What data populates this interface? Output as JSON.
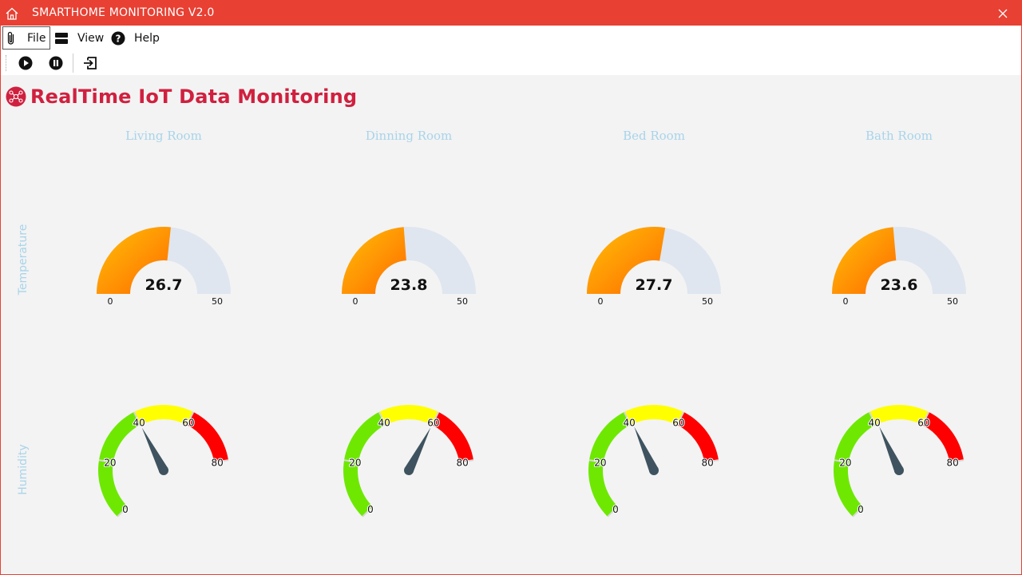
{
  "window": {
    "title": "SMARTHOME MONITORING V2.0"
  },
  "menu": {
    "file": "File",
    "view": "View",
    "help": "Help"
  },
  "toolbar": {
    "icons": [
      "play-icon",
      "pause-icon",
      "exit-icon"
    ]
  },
  "heading": {
    "text": "RealTime IoT Data Monitoring"
  },
  "rows": {
    "temperature": "Temperature",
    "humidity": "Humidity"
  },
  "rooms": [
    {
      "name": "Living Room",
      "temperature": 26.7,
      "temperature_label": "26.7",
      "humidity": 40
    },
    {
      "name": "Dinning Room",
      "temperature": 23.8,
      "temperature_label": "23.8",
      "humidity": 60
    },
    {
      "name": "Bed Room",
      "temperature": 27.7,
      "temperature_label": "27.7",
      "humidity": 41
    },
    {
      "name": "Bath Room",
      "temperature": 23.6,
      "temperature_label": "23.6",
      "humidity": 41
    }
  ],
  "temperature_scale": {
    "min": 0,
    "max": 50,
    "min_label": "0",
    "max_label": "50"
  },
  "humidity_scale": {
    "min": 0,
    "max": 100,
    "ticks": [
      "0",
      "20",
      "40",
      "60",
      "80"
    ]
  },
  "colors": {
    "titlebar": "#e84033",
    "heading": "#d0203f",
    "label": "#a8d4ea",
    "temp_fill_start": "#ffc107",
    "temp_fill_end": "#ff6a00",
    "temp_track": "#dfe6ef",
    "hum_green": "#6ee800",
    "hum_yellow": "#ffff00",
    "hum_red": "#ff0000",
    "needle": "#3e535f"
  }
}
